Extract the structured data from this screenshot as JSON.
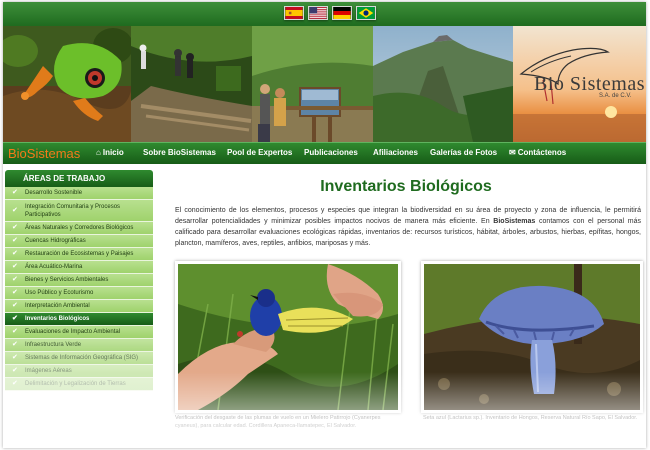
{
  "languages": [
    {
      "name": "Español",
      "icon": "flag-spain-icon"
    },
    {
      "name": "English",
      "icon": "flag-usa-icon"
    },
    {
      "name": "Deutsch",
      "icon": "flag-germany-icon"
    },
    {
      "name": "Português",
      "icon": "flag-brazil-icon"
    }
  ],
  "banner": {
    "logo_title": "Bio Sistemas",
    "logo_subtitle": "S.A. de C.V.",
    "logo_icon": "bird-icon"
  },
  "nav": {
    "brand": "BioSistemas",
    "items": [
      {
        "label": "Inicio",
        "icon": "home-icon"
      },
      {
        "label": "Sobre BioSistemas"
      },
      {
        "label": "Pool de Expertos"
      },
      {
        "label": "Publicaciones"
      },
      {
        "label": "Afiliaciones"
      },
      {
        "label": "Galerías de Fotos"
      },
      {
        "label": "Contáctenos",
        "icon": "mail-icon"
      }
    ]
  },
  "sidebar": {
    "title": "ÁREAS DE TRABAJO",
    "active_index": 12,
    "items": [
      "Desarrollo Sostenible",
      "Integración Comunitaria y Procesos Participativos",
      "Áreas Naturales y Corredores Biológicos",
      "Cuencas Hidrográficas",
      "Restauración de Ecosistemas y Paisajes",
      "Área Acuático-Marina",
      "Bienes y Servicios Ambientales",
      "Uso Público y Ecoturismo",
      "Interpretación Ambiental",
      "Inventarios Biológicos",
      "Evaluaciones de Impacto Ambiental",
      "Infraestructura Verde",
      "Sistemas de Información Geográfica (SIG)",
      "Imágenes Aéreas",
      "Delimitación y Legalización de Tierras"
    ]
  },
  "main": {
    "title": "Inventarios Biológicos",
    "intro_1": "El conocimiento de los elementos, procesos y especies que integran la biodiversidad en su área de proyecto y zona de influencia, le permitirá desarrollar potencialidades y minimizar posibles impactos nocivos de manera más eficiente. En ",
    "intro_brand": "BioSistemas",
    "intro_2": " contamos con el personal más calificado para desarrollar evaluaciones ecológicas rápidas, inventarios de: recursos turísticos, hábitat, árboles, arbustos, hierbas, epífitas, hongos, plancton, mamíferos, aves, reptiles, anfibios, mariposas y más.",
    "photos": [
      {
        "caption": "Verificación del desgaste de las plumas de vuelo en un Mielero Patirrojo (Cyanerpes cyaneus), para calcular edad. Cordillera Apaneca-Ilamatepec, El Salvador."
      },
      {
        "caption": "Seta azul (Lactarius sp.). Inventario de Hongos, Reserva Natural Río Sapo, El Salvador."
      }
    ]
  },
  "colors": {
    "brand_green": "#1f6b1f",
    "nav_brand_orange": "#f47a1a",
    "sidebar_light": "#a9d779"
  }
}
